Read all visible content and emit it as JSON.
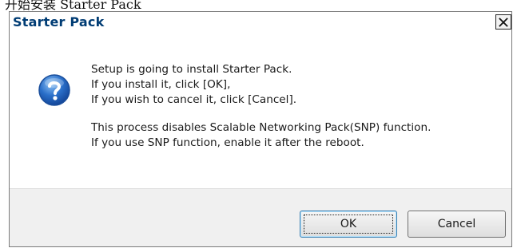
{
  "caption": "开始安装 Starter Pack",
  "dialog": {
    "title": "Starter Pack",
    "close_glyph": "✕",
    "icon": "question-icon",
    "message_lines": [
      "Setup is going to install Starter Pack.",
      "If you install it, click [OK],",
      "If you wish to cancel it, click [Cancel].",
      "This process disables Scalable Networking Pack(SNP) function.",
      "If you use SNP function, enable it after the reboot."
    ],
    "buttons": {
      "ok": "OK",
      "cancel": "Cancel"
    },
    "colors": {
      "title_text": "#003c74",
      "icon_blue": "#2a6fc9",
      "footer_bg": "#f0f0f0"
    }
  }
}
